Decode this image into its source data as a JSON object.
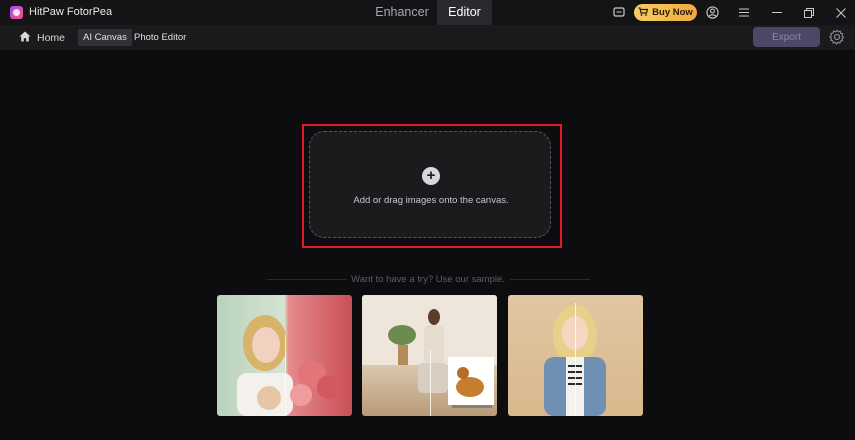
{
  "titlebar": {
    "app_name": "HitPaw FotorPea",
    "tabs": [
      {
        "label": "Enhancer",
        "active": false
      },
      {
        "label": "Editor",
        "active": true
      }
    ],
    "buy_label": "Buy Now",
    "icons": [
      "chat-icon",
      "cart-icon",
      "account-icon",
      "menu-icon",
      "minimize-icon",
      "restore-icon",
      "close-icon"
    ]
  },
  "navbar": {
    "home_label": "Home",
    "tabs": [
      {
        "label": "AI Canvas",
        "active": true
      },
      {
        "label": "Photo Editor",
        "active": false
      }
    ],
    "export_label": "Export",
    "export_enabled": false
  },
  "canvas": {
    "drop_text": "Add or drag images onto the canvas.",
    "sample_prompt": "Want to have a try? Use our sample."
  },
  "samples": [
    "sample-portrait-bouquet",
    "sample-seated-woman-dog",
    "sample-denim-portrait"
  ],
  "colors": {
    "accent": "#e01b24",
    "buy_gradient_start": "#f5cf63",
    "buy_gradient_end": "#f0a93c",
    "export_bg": "#4a4866"
  }
}
